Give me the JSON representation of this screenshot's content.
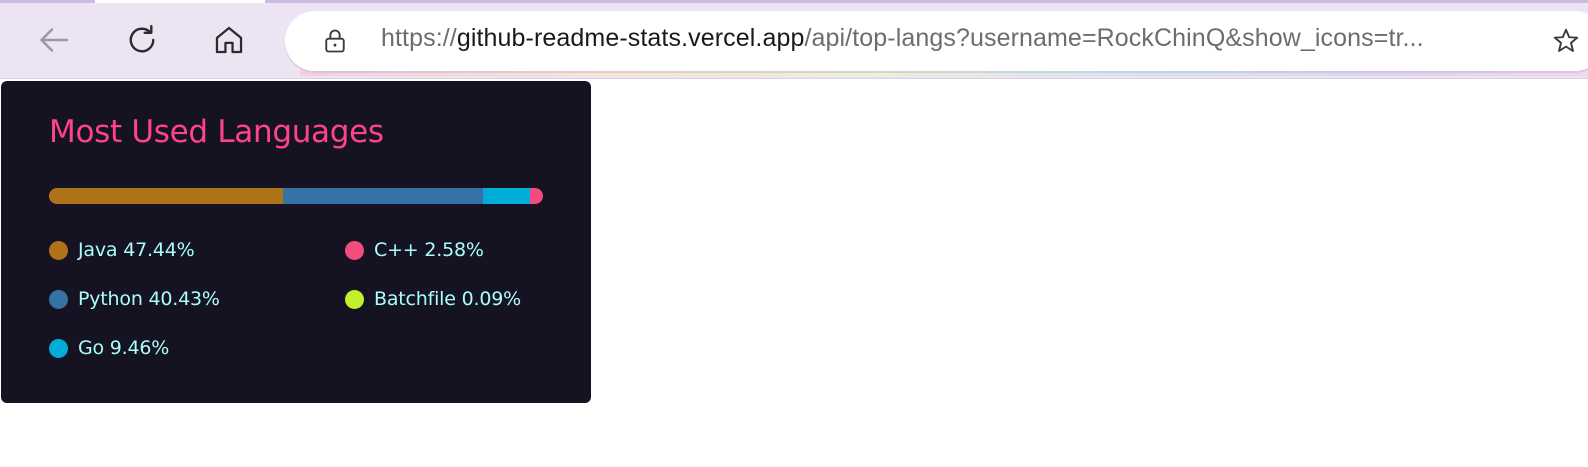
{
  "browser": {
    "url_scheme": "https://",
    "url_host": "github-readme-stats.vercel.app",
    "url_path": "/api/top-langs?username=RockChinQ&show_icons=tr...",
    "back_icon": "back-arrow-icon",
    "reload_icon": "reload-icon",
    "home_icon": "home-icon",
    "site_info_icon": "lock-icon",
    "favorite_icon": "star-icon"
  },
  "card": {
    "title": "Most Used Languages",
    "colors": {
      "background": "#151321",
      "title": "#fe428e",
      "text": "#a9fef7"
    },
    "languages": [
      {
        "name": "Java",
        "percent_label": "47.44%",
        "percent": 47.44,
        "color": "#b07219"
      },
      {
        "name": "Python",
        "percent_label": "40.43%",
        "percent": 40.43,
        "color": "#3572A5"
      },
      {
        "name": "Go",
        "percent_label": "9.46%",
        "percent": 9.46,
        "color": "#00ADD8"
      },
      {
        "name": "C++",
        "percent_label": "2.58%",
        "percent": 2.58,
        "color": "#f34b7d"
      },
      {
        "name": "Batchfile",
        "percent_label": "0.09%",
        "percent": 0.09,
        "color": "#C1F12E"
      }
    ]
  }
}
